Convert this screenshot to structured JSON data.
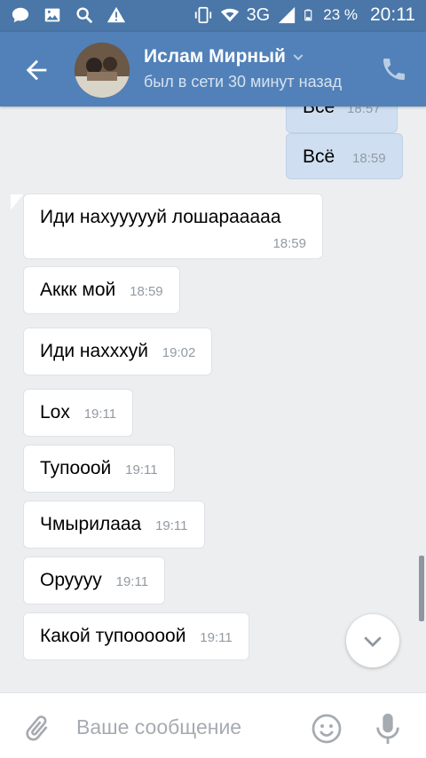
{
  "status_bar": {
    "network": "3G",
    "battery": "23 %",
    "time": "20:11",
    "left_icons": [
      "chat-icon",
      "image-icon",
      "search-icon",
      "warning-icon"
    ],
    "right_icons": [
      "vibrate-icon",
      "wifi-icon",
      "signal-icon",
      "battery-icon"
    ]
  },
  "header": {
    "name": "Ислам Мирный",
    "status": "был в сети 30 минут назад",
    "accent": "#5181b8"
  },
  "messages": [
    {
      "dir": "out",
      "text": "Всё",
      "time": "18:57"
    },
    {
      "dir": "out",
      "text": "Всё",
      "time": "18:59"
    },
    {
      "dir": "in",
      "text": "Иди нахуууууй лошарааааа",
      "time": "18:59"
    },
    {
      "dir": "in",
      "text": "Аккк мой",
      "time": "18:59"
    },
    {
      "dir": "in",
      "text": "Иди нахххуй",
      "time": "19:02"
    },
    {
      "dir": "in",
      "text": "Lox",
      "time": "19:11"
    },
    {
      "dir": "in",
      "text": "Тупооой",
      "time": "19:11"
    },
    {
      "dir": "in",
      "text": "Чмырилааа",
      "time": "19:11"
    },
    {
      "dir": "in",
      "text": "Оруууу",
      "time": "19:11"
    },
    {
      "dir": "in",
      "text": "Какой тупооооой",
      "time": "19:11"
    }
  ],
  "composer": {
    "placeholder": "Ваше сообщение"
  }
}
